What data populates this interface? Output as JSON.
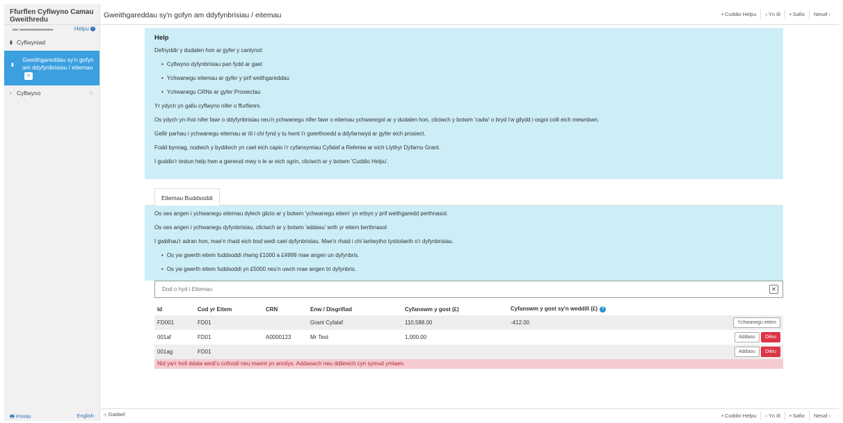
{
  "sidebar": {
    "title": "Ffurflen Cyflwyno Camau Gweithredu",
    "cut_text": "▬ ▬▬▬▬▬▬",
    "help_link": "Helpu",
    "items": [
      {
        "label": "Cyflwyniad",
        "icon": "▮"
      },
      {
        "label": "Gweithgareddau sy'n gofyn am ddyfynbrisiau / eitemau",
        "icon": "▮",
        "badge": "✕"
      },
      {
        "label": "Cyflwyno",
        "icon": "›",
        "count": "0"
      }
    ],
    "print_label": "Printio",
    "english_label": "English"
  },
  "header": {
    "title": "Gweithgareddau sy'n gofyn am ddyfynbrisiau / eitemau",
    "hide_help": "Cuddio Helpu",
    "back": "Yn ôl",
    "save": "Safio",
    "next": "Nesaf"
  },
  "footer": {
    "exit": "Gadael",
    "hide_help": "Cuddio Helpu",
    "back": "Yn ôl",
    "save": "Safio",
    "next": "Nesaf"
  },
  "help": {
    "heading": "Help",
    "intro": "Defnyddir y dudalen hon ar gyfer y canlynol:",
    "bullets": [
      "Cyflwyno dyfynbrisiau pan fydd ar gael",
      "Ychwanegu eitemau ar gyfer y prif weithgareddau",
      "Ychwanegu CRNs ar gyfer Prosiectau"
    ],
    "paras": [
      "Yr ydych yn gallu cyflwyno nifer o ffurflenni.",
      "Os ydych yn rhoi nifer fawr o ddyfynbrisiau neu'n ychwanegu nifer fawr o eitemau ychwanegol ar y dudalen hon, cliciwch y botwm 'cadw' o bryd i'w gilydd i osgoi colli eich mewnbwn.",
      "Gellir parhau i ychwanegu eitemau ar ôl i chi fynd y tu hwnt i'r gwerthoedd a ddyfarnwyd ar gyfer eich prosiect.",
      "Fodd bynnag, nodwch y byddwch yn cael eich capio i'r cyfansymiau Cyfalaf a Refeniw ar eich Llythyr Dyfarnu Grant.",
      "I guddio'r testun help hwn a gwneud mwy o le ar eich sgrin, cliciwch ar y botwm 'Cuddio Helpu'."
    ]
  },
  "tab": {
    "label": "Eitemau Buddsoddi"
  },
  "info": {
    "paras": [
      "Os oes angen i ychwanegu eitemau dylech glicio ar y botwm 'ychwanegu eitem' yn erbyn y prif weithgaredd perthnasol.",
      "Os oes angen i ychwanegu dyfynbrisiau, cliciwch ar y botwm 'addasu' wrth yr eitem berthnasol",
      "I gwblhau'r adran hon, mae'n rhaid eich bod wedi cael dyfynbrisiau. Mae'n rhaid i chi lanlwytho tystiolaeth o'r dyfynbrisiau."
    ],
    "bullets": [
      "Os yw gwerth eitem fuddsoddi rhwng £1000 a £4999 mae angen un dyfynbris.",
      "Os yw gwerth eitem fuddsoddi yn £5000 neu'n uwch mae angen tri dyfynbris."
    ]
  },
  "search": {
    "placeholder": "Dod o hyd i Eitemau",
    "clear": "✕"
  },
  "table": {
    "headers": [
      "Id",
      "Cod yr Eitem",
      "CRN",
      "Enw / Disgrifiad",
      "Cyfanswm y gost (£)",
      "Cyfanswm y gost sy'n weddill (£)"
    ],
    "info_icon": "?",
    "rows": [
      {
        "id": "FD001",
        "code": "FD01",
        "crn": "",
        "name": "Grant Cyfalaf",
        "total": "110,588.00",
        "remaining": "-412.00",
        "add_label": "Ychwanegu eitem"
      },
      {
        "id": "001af",
        "code": "FD01",
        "crn": "A0000123",
        "name": "Mr Test",
        "total": "1,000.00",
        "remaining": "",
        "edit_label": "Addasu",
        "delete_label": "Dileu"
      },
      {
        "id": "001ag",
        "code": "FD01",
        "crn": "",
        "name": "",
        "total": "",
        "remaining": "",
        "edit_label": "Addasu",
        "delete_label": "Dileu"
      }
    ]
  },
  "error": "Nid yw'r holl ddata wedi'u cofnodi neu maent yn annilys. Addaswch neu ddilewch cyn symud ymlaen."
}
